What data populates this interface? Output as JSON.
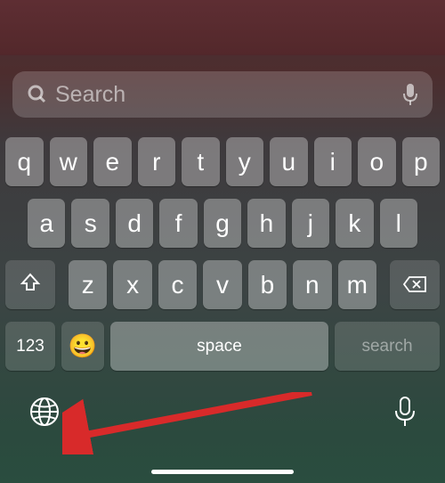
{
  "search": {
    "placeholder": "Search"
  },
  "keyboard": {
    "row1": [
      "q",
      "w",
      "e",
      "r",
      "t",
      "y",
      "u",
      "i",
      "o",
      "p"
    ],
    "row2": [
      "a",
      "s",
      "d",
      "f",
      "g",
      "h",
      "j",
      "k",
      "l"
    ],
    "row3": [
      "z",
      "x",
      "c",
      "v",
      "b",
      "n",
      "m"
    ],
    "numbers_label": "123",
    "space_label": "space",
    "search_label": "search"
  },
  "icons": {
    "search": "search-icon",
    "mic": "microphone-icon",
    "shift": "shift-icon",
    "delete": "delete-icon",
    "emoji": "😀",
    "globe": "globe-icon",
    "dictate": "microphone-icon"
  }
}
